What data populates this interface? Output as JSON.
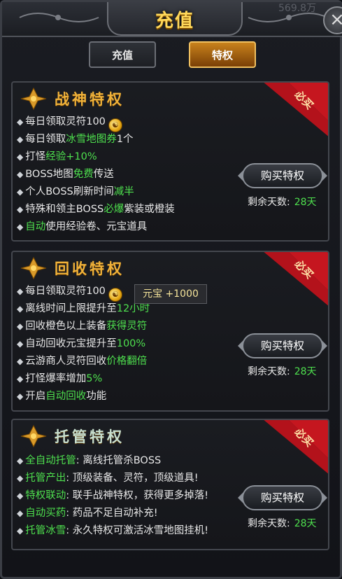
{
  "window": {
    "title": "充值",
    "top_number": "569.8万"
  },
  "tabs": [
    {
      "label": "充值",
      "active": false
    },
    {
      "label": "特权",
      "active": true
    }
  ],
  "badge_text": "必买",
  "cards": [
    {
      "title": "战神特权",
      "lines": [
        {
          "parts": [
            "每日领取灵符",
            "100"
          ],
          "coin": true
        },
        {
          "parts": [
            "每日领取",
            "冰雪地图券",
            "1个"
          ]
        },
        {
          "parts": [
            "打怪",
            "经验+10%",
            ""
          ]
        },
        {
          "parts": [
            "BOSS地图",
            "免费",
            "传送"
          ]
        },
        {
          "parts": [
            "个人BOSS刷新时间",
            "减半",
            ""
          ]
        },
        {
          "parts": [
            "特殊和领主BOSS",
            "必爆",
            "紫装或橙装"
          ]
        },
        {
          "parts": [
            "",
            "自动",
            "使用经验卷、元宝道具"
          ]
        }
      ],
      "buy_label": "购买特权",
      "days_label": "剩余天数:",
      "days_value": "28天"
    },
    {
      "title": "回收特权",
      "lines": [
        {
          "parts": [
            "每日领取灵符",
            "100"
          ],
          "coin": true
        },
        {
          "parts": [
            "离线时间上限提升至",
            "12小时",
            ""
          ]
        },
        {
          "parts": [
            "回收橙色以上装备",
            "获得灵符",
            ""
          ]
        },
        {
          "parts": [
            "自动回收元宝提升至",
            "100%",
            ""
          ]
        },
        {
          "parts": [
            "云游商人灵符回收",
            "价格翻倍",
            ""
          ]
        },
        {
          "parts": [
            "打怪爆率增加",
            "5%",
            ""
          ]
        },
        {
          "parts": [
            "开启",
            "自动回收",
            "功能"
          ]
        }
      ],
      "tooltip": "元宝  +1000",
      "buy_label": "购买特权",
      "days_label": "剩余天数:",
      "days_value": "28天"
    },
    {
      "title": "托管特权",
      "lines": [
        {
          "parts": [
            "",
            "全自动托管",
            ":  离线托管杀BOSS"
          ]
        },
        {
          "parts": [
            "",
            "托管产出",
            ":  顶级装备、灵符，顶级道具!"
          ]
        },
        {
          "parts": [
            "",
            "特权联动",
            ":  联手战神特权，获得更多掉落!"
          ]
        },
        {
          "parts": [
            "",
            "自动买药",
            ":  药品不足自动补充!"
          ]
        },
        {
          "parts": [
            "",
            "托管冰雪",
            ":  永久特权可激活冰雪地图挂机!"
          ]
        }
      ],
      "buy_label": "购买特权",
      "days_label": "剩余天数:",
      "days_value": "28天"
    }
  ],
  "colors": {
    "gold": "#f0b23a",
    "green": "#4ee04e",
    "banner": "#b3121b"
  },
  "icons": {
    "emblem": "lotus-emblem-icon",
    "coin": "coin-icon",
    "close": "close-icon",
    "bullet": "diamond-bullet-icon"
  }
}
